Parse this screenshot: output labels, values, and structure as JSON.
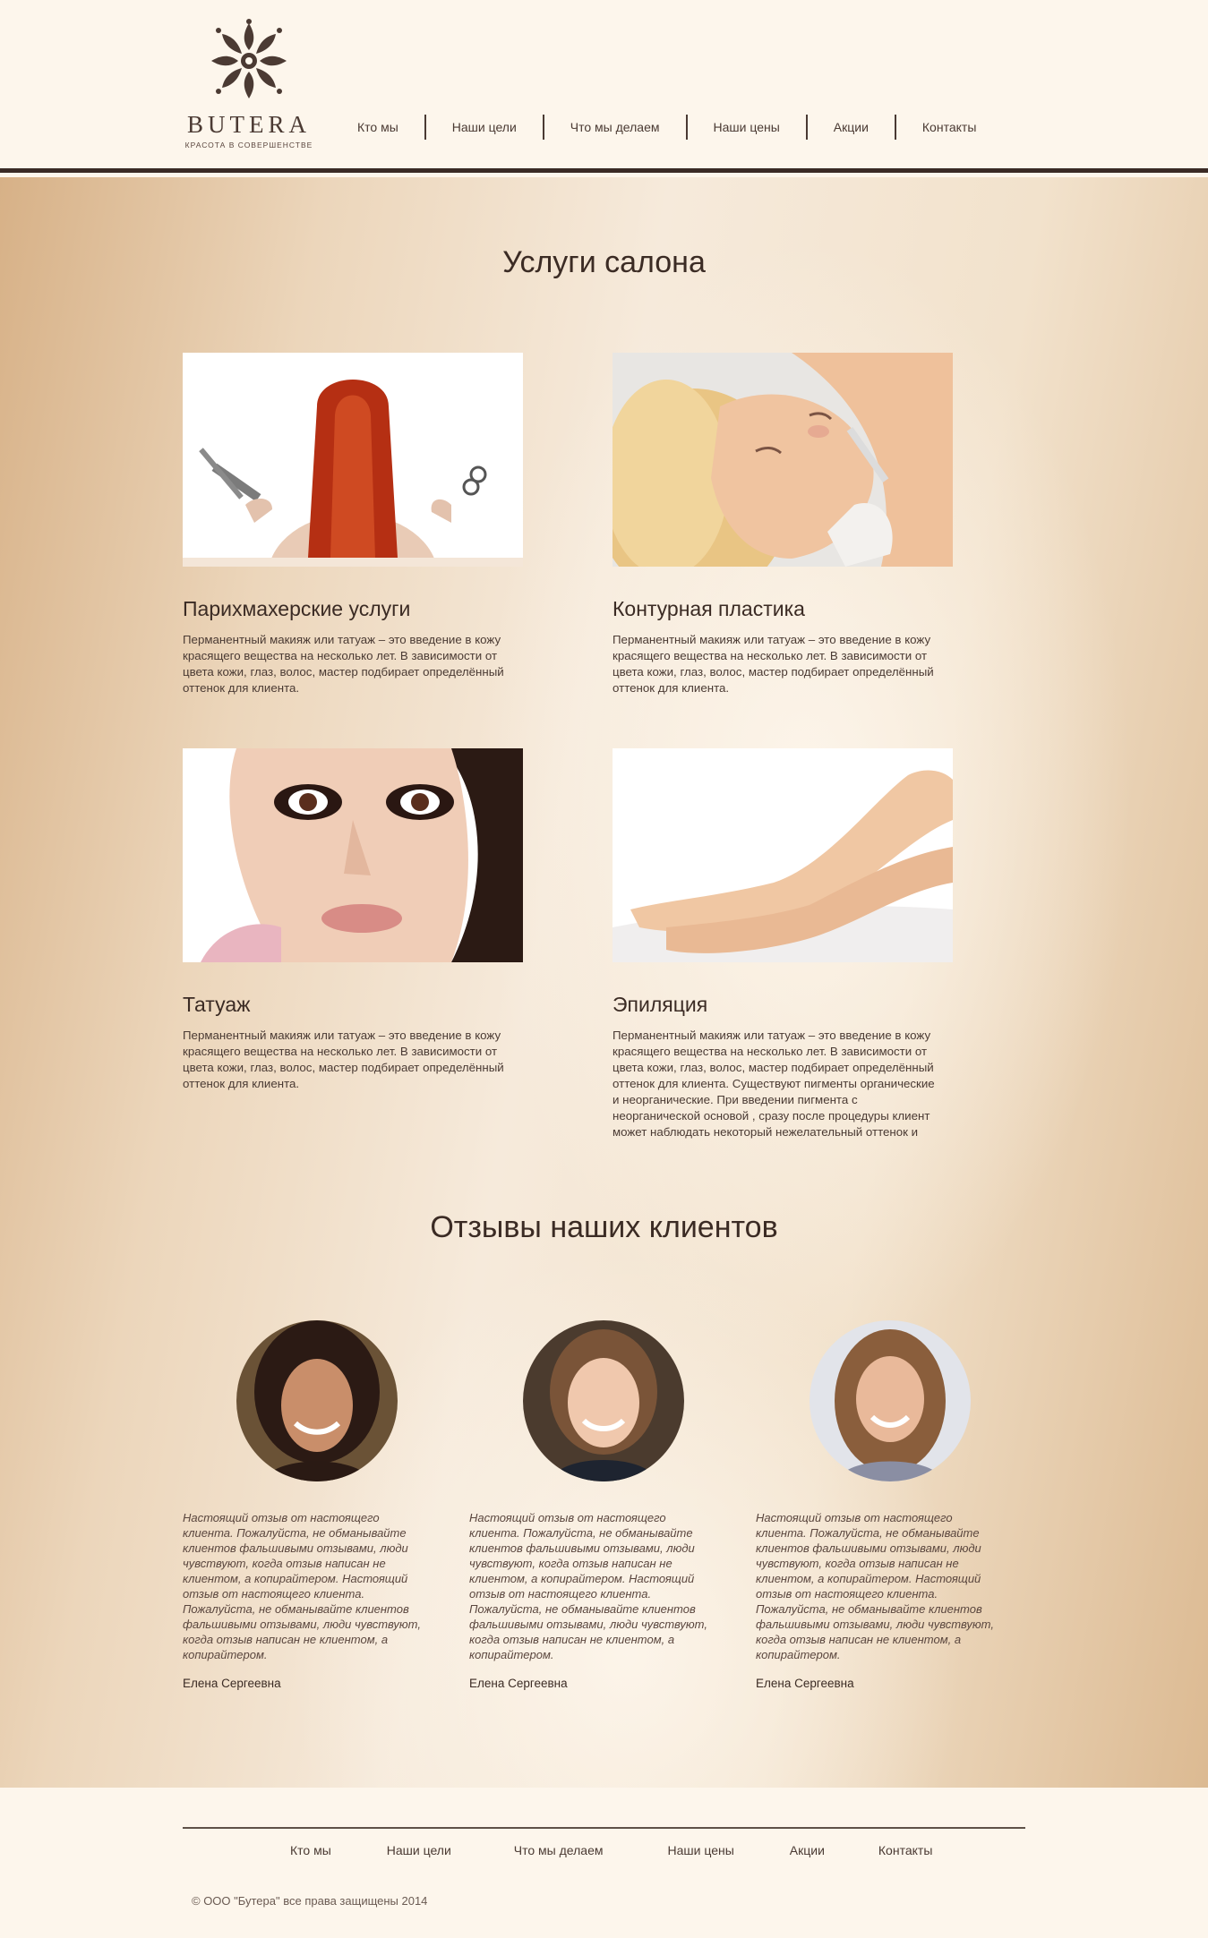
{
  "brand": {
    "name": "BUTERA",
    "tagline": "КРАСОТА В СОВЕРШЕНСТВЕ"
  },
  "nav": {
    "items": [
      "Кто мы",
      "Наши цели",
      "Что мы делаем",
      "Наши цены",
      "Акции",
      "Контакты"
    ]
  },
  "services": {
    "title": "Услуги салона",
    "items": [
      {
        "title": "Парихмахерские услуги",
        "text": "Перманентный макияж или татуаж – это введение в кожу красящего вещества на несколько лет. В зависимости от цвета кожи, глаз, волос, мастер подбирает определённый оттенок для клиента."
      },
      {
        "title": "Контурная пластика",
        "text": "Перманентный макияж или татуаж – это введение в кожу красящего вещества на несколько лет. В зависимости от цвета кожи, глаз, волос, мастер подбирает определённый оттенок для клиента."
      },
      {
        "title": "Татуаж",
        "text": "Перманентный макияж или татуаж – это введение в кожу красящего вещества на несколько лет. В зависимости от цвета кожи, глаз, волос, мастер подбирает определённый оттенок для клиента."
      },
      {
        "title": "Эпиляция",
        "text": "Перманентный макияж или татуаж – это введение в кожу красящего вещества на несколько лет. В зависимости от цвета кожи, глаз, волос, мастер подбирает определённый оттенок для клиента. Существуют пигменты органические и неорганические. При введении пигмента с неорганической основой , сразу после процедуры клиент может наблюдать некоторый нежелательный оттенок и"
      }
    ]
  },
  "reviews": {
    "title": "Отзывы наших клиентов",
    "items": [
      {
        "text": "Настоящий отзыв от настоящего клиента. Пожалуйста, не обманывайте клиентов фальшивыми отзывами, люди чувствуют, когда отзыв написан не клиентом, а копирайтером. Настоящий отзыв от настоящего клиента. Пожалуйста, не обманывайте клиентов фальшивыми отзывами, люди чувствуют, когда отзыв написан не клиентом, а копирайтером.",
        "author": "Елена Сергеевна"
      },
      {
        "text": "Настоящий отзыв от настоящего клиента. Пожалуйста, не обманывайте клиентов фальшивыми отзывами, люди чувствуют, когда отзыв написан не клиентом, а копирайтером. Настоящий отзыв от настоящего клиента. Пожалуйста, не обманывайте клиентов фальшивыми отзывами, люди чувствуют, когда отзыв написан не клиентом, а копирайтером.",
        "author": "Елена Сергеевна"
      },
      {
        "text": "Настоящий отзыв от настоящего клиента. Пожалуйста, не обманывайте клиентов фальшивыми отзывами, люди чувствуют, когда отзыв написан не клиентом, а копирайтером. Настоящий отзыв от настоящего клиента. Пожалуйста, не обманывайте клиентов фальшивыми отзывами, люди чувствуют, когда отзыв написан не клиентом, а копирайтером.",
        "author": "Елена Сергеевна"
      }
    ]
  },
  "footer": {
    "nav": [
      "Кто мы",
      "Наши цели",
      "Что мы делаем",
      "Наши цены",
      "Акции",
      "Контакты"
    ],
    "copyright": "© ООО \"Бутера\" все права защищены 2014"
  },
  "colors": {
    "text_dark": "#3b2b24",
    "header_bg": "#fdf6ec",
    "header_border": "#3a2a25",
    "gradient_warm": "#d7b187"
  }
}
